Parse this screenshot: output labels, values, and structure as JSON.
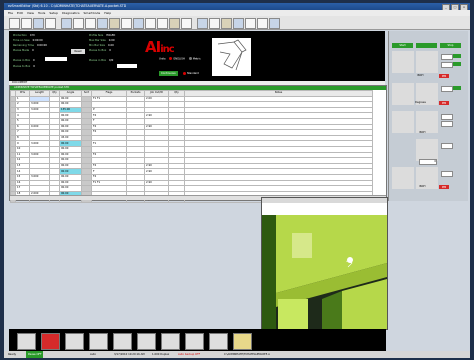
{
  "window": {
    "title": "ezSmartEditor (Std) 6.10 - C:\\ADMINHATE\\TCHATEAUERVATE.A.pocket.STD",
    "buttons": [
      "_",
      "□",
      "x"
    ]
  },
  "menu": [
    "File",
    "Edit",
    "View",
    "Tools",
    "Setup",
    "Diagnostics",
    "SmartCode",
    "Help"
  ],
  "stats": [
    {
      "label": "Production",
      "value": "0 M"
    },
    {
      "label": "Time on Saw",
      "value": "0:00:00"
    },
    {
      "label": "Remaining Time",
      "value": "0:00:00"
    },
    {
      "label": "Pieces Made",
      "value": "0"
    },
    {
      "label": "Pieces in Box",
      "value": "0"
    },
    {
      "label": "Pieces to Box",
      "value": "0"
    }
  ],
  "stats2": [
    {
      "label": "Profile Size",
      "value": "HOLED"
    },
    {
      "label": "Max Bar Size",
      "value": "0.00"
    },
    {
      "label": "Min Bar Size",
      "value": "0.00"
    },
    {
      "label": "Pieces to Box",
      "value": "0"
    },
    {
      "label": "Pieces in Box",
      "value": "0/0"
    }
  ],
  "reset_label": "Reset",
  "logo": {
    "main": "AI",
    "suffix": "inc"
  },
  "units": {
    "label": "Units",
    "selected": "ENGLISH",
    "other": "Metric"
  },
  "modes": {
    "continuous": "Continuous",
    "standard": "Standard"
  },
  "job_label": "DOCUMENT",
  "grid": {
    "title": "ADMINHATE TCHATEAUERVATE pocket.STD",
    "columns": [
      "Prts",
      "Length",
      "Qty",
      "Angle",
      "Sort",
      "Flags",
      "Pockets",
      "Job Cut/ID",
      "Qty",
      "Notes"
    ],
    "rows": [
      [
        "1",
        "",
        "",
        "90.00",
        "",
        "F1 F1",
        "",
        "2.00",
        "",
        ""
      ],
      [
        "2",
        "3.000",
        "",
        "90.00",
        "",
        "",
        "",
        "",
        "",
        ""
      ],
      [
        "3",
        "3.000",
        "",
        "135.00",
        "",
        "P",
        "",
        "",
        "",
        ""
      ],
      [
        "4",
        "",
        "",
        "90.00",
        "",
        "F4",
        "",
        "2.90",
        "",
        ""
      ],
      [
        "5",
        "",
        "",
        "90.00",
        "",
        "F",
        "",
        "",
        "",
        ""
      ],
      [
        "6",
        "0.000",
        "",
        "90.00",
        "",
        "F4",
        "",
        "2.90",
        "",
        ""
      ],
      [
        "7",
        "",
        "",
        "90.00",
        "",
        "F4",
        "",
        "",
        "",
        ""
      ],
      [
        "8",
        "",
        "",
        "45.00",
        "",
        "",
        "",
        "",
        "",
        ""
      ],
      [
        "9",
        "3.000",
        "",
        "90.00",
        "",
        "F1",
        "",
        "",
        "",
        ""
      ],
      [
        "10",
        "",
        "",
        "90.00",
        "",
        "",
        "",
        "",
        "",
        ""
      ],
      [
        "11",
        "3.000",
        "",
        "90.00",
        "",
        "F4",
        "",
        "",
        "",
        ""
      ],
      [
        "12",
        "",
        "",
        "90.00",
        "",
        "",
        "",
        "",
        "",
        ""
      ],
      [
        "13",
        "",
        "",
        "90.00",
        "",
        "F4",
        "",
        "2.90",
        "",
        ""
      ],
      [
        "14",
        "",
        "",
        "90.00",
        "",
        "F",
        "",
        "2.90",
        "",
        ""
      ],
      [
        "15",
        "3.000",
        "",
        "90.00",
        "",
        "F4",
        "",
        "",
        "",
        ""
      ],
      [
        "16",
        "",
        "",
        "90.00",
        "",
        "F1 F1",
        "",
        "2.90",
        "",
        ""
      ],
      [
        "17",
        "",
        "",
        "90.00",
        "",
        "",
        "",
        "",
        "",
        ""
      ],
      [
        "18",
        "2.000",
        "",
        "90.00",
        "",
        "",
        "",
        "",
        "",
        ""
      ],
      [
        "19",
        "0.000",
        "",
        "90.00",
        "",
        "F, S3",
        "",
        "Squared",
        "",
        ""
      ]
    ]
  },
  "side": {
    "top_buttons": [
      "Start",
      "",
      "Stop"
    ],
    "unit_labels": [
      "INCH",
      "MM",
      "Degrees",
      "MM",
      "INCH",
      "INCH",
      "MM"
    ],
    "value": "0"
  },
  "status": {
    "ready": "Ready",
    "state": "Pause OFF",
    "mode": "Auto",
    "time": "3/17/2010 10:20:16 AM",
    "speed": "1.000 Duplex",
    "backup": "Auto backup OFF",
    "file": "C:\\ADMINHATE\\TCHATEAUERVATE.A"
  },
  "colors": {
    "accent_green": "#2a9a2a",
    "logo_red": "#d80000",
    "highlight_cyan": "#7fd9e8",
    "stop_red": "#d62a2a"
  }
}
